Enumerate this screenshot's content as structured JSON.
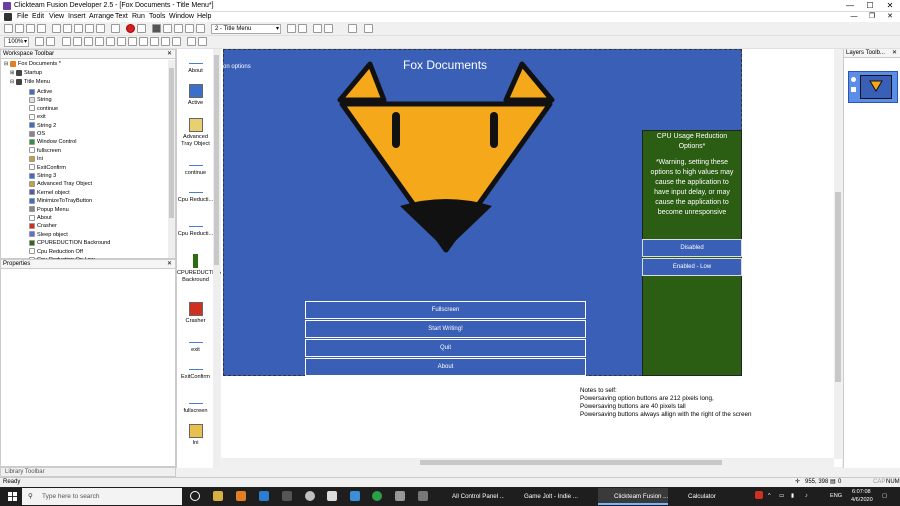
{
  "window": {
    "title": "Clickteam Fusion Developer 2.5 - [Fox Documents - Title Menu*]",
    "minimize": "—",
    "maximize": "☐",
    "close": "✕"
  },
  "menu": {
    "items": [
      "File",
      "Edit",
      "View",
      "Insert",
      "Arrange",
      "Text",
      "Run",
      "Tools",
      "Window",
      "Help"
    ],
    "mdi_min": "—",
    "mdi_restore": "❐",
    "mdi_close": "✕"
  },
  "toolbar": {
    "frame_select": "2 - Title Menu",
    "zoom": "100%"
  },
  "workspace": {
    "title": "Workspace Toolbar",
    "close": "✕",
    "root": "Fox Documents *",
    "frames": [
      "Startup",
      "Title Menu"
    ],
    "items": [
      {
        "label": "Active",
        "color": "#3b6fc9"
      },
      {
        "label": "String",
        "color": "#e0e0e0"
      },
      {
        "label": "continue",
        "color": "#ffffff"
      },
      {
        "label": "exit",
        "color": "#ffffff"
      },
      {
        "label": "String 2",
        "color": "#3b6fc9"
      },
      {
        "label": "OS",
        "color": "#888888"
      },
      {
        "label": "Window Control",
        "color": "#3a8f3a"
      },
      {
        "label": "fullscreen",
        "color": "#ffffff"
      },
      {
        "label": "Ini",
        "color": "#c8a040"
      },
      {
        "label": "ExitConfirm",
        "color": "#ffffff"
      },
      {
        "label": "String 3",
        "color": "#3b6fc9"
      },
      {
        "label": "Advanced Tray Object",
        "color": "#c8a040"
      },
      {
        "label": "Kernel object",
        "color": "#5a5aa0"
      },
      {
        "label": "MinimizeToTrayButton",
        "color": "#3b6fc9"
      },
      {
        "label": "Popup Menu",
        "color": "#888888"
      },
      {
        "label": "About",
        "color": "#ffffff"
      },
      {
        "label": "Crasher",
        "color": "#d03020"
      },
      {
        "label": "Sleep object",
        "color": "#6a6acc"
      },
      {
        "label": "CPUREDUCTION Backround",
        "color": "#2b6d12"
      },
      {
        "label": "Cpu Reduction Off",
        "color": "#ffffff"
      },
      {
        "label": "Cpu Reduction On Low",
        "color": "#ffffff"
      }
    ]
  },
  "properties": {
    "title": "Properties",
    "close": "✕"
  },
  "library": {
    "title": "Library Toolbar"
  },
  "objects": [
    {
      "label": "About",
      "kind": "line"
    },
    {
      "label": "Active",
      "kind": "icon",
      "color": "#3b6fc9"
    },
    {
      "label": "Advanced Tray Object",
      "kind": "icon",
      "color": "#e8d070"
    },
    {
      "label": "continue",
      "kind": "line"
    },
    {
      "label": "Cpu Reducti...",
      "kind": "line"
    },
    {
      "label": "Cpu Reducti...",
      "kind": "line"
    },
    {
      "label": "CPUREDUCTION Backround",
      "kind": "bar",
      "color": "#2b6d12"
    },
    {
      "label": "Crasher",
      "kind": "icon",
      "color": "#d03020"
    },
    {
      "label": "exit",
      "kind": "line"
    },
    {
      "label": "ExitConfirm",
      "kind": "line"
    },
    {
      "label": "fullscreen",
      "kind": "line"
    },
    {
      "label": "Ini",
      "kind": "icon",
      "color": "#e8c050"
    }
  ],
  "frame": {
    "title": "Fox Documents",
    "subtext": "on options",
    "buttons": [
      "Fullscreen",
      "Start Writing!",
      "Quit",
      "About"
    ],
    "bg_color": "#3a5fb6"
  },
  "cpu_panel": {
    "heading": "CPU Usage Reduction Options*",
    "warning": "*Warning, setting these options to high values may cause the application to have input delay, or may cause the application to become unresponsive",
    "buttons": [
      "Disabled",
      "Enabled - Low"
    ],
    "bg_color": "#2b5d12"
  },
  "notes": [
    "Notes to self:",
    "Powersaving option buttons are 212 pixels long,",
    "Powersaving buttons are 40 pixels tall",
    "Powersaving buttons always allign with the right of the screen"
  ],
  "layers": {
    "title": "Layers Toolb...",
    "close": "✕"
  },
  "status": {
    "left": "Ready",
    "coords": "955, 398",
    "count": "0",
    "caps": "CAP",
    "num": "NUM"
  },
  "taskbar": {
    "search_placeholder": "Type here to search",
    "tasks": [
      "All Control Panel ...",
      "Game Jolt - Indie ...",
      "Clickteam Fusion ...",
      "Calculator"
    ],
    "lang": "ENG",
    "time": "6:07:08",
    "date": "4/6/2020"
  }
}
